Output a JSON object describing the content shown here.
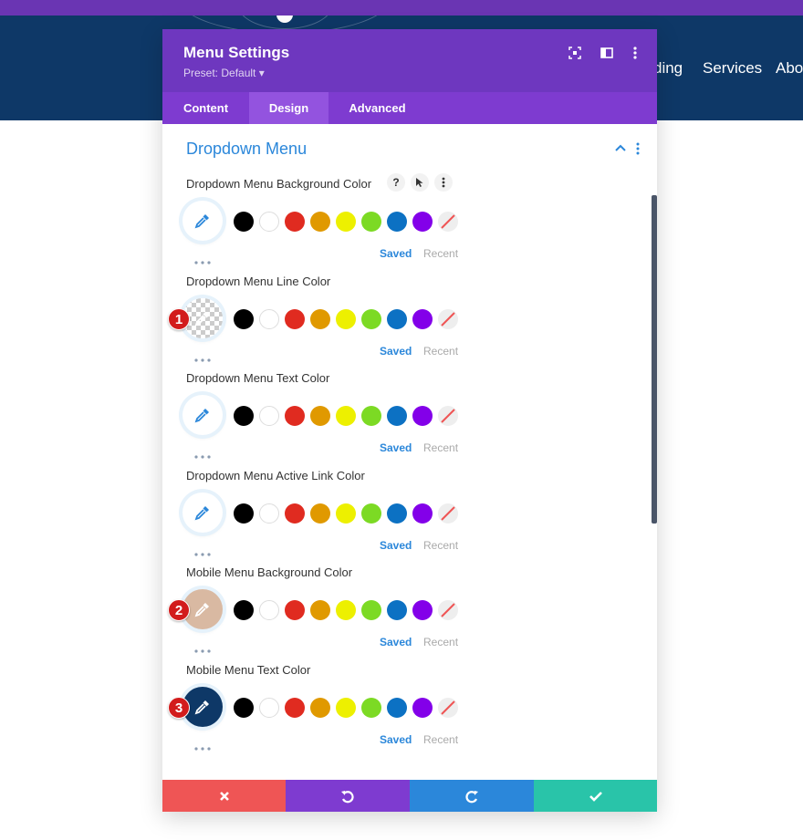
{
  "site": {
    "nav": [
      "ding",
      "Services",
      "Abo"
    ]
  },
  "modal": {
    "title": "Menu Settings",
    "preset": "Preset: Default ▾",
    "tabs": [
      "Content",
      "Design",
      "Advanced"
    ],
    "active_tab": "Design",
    "section_title": "Dropdown Menu",
    "settings": [
      {
        "label": "Dropdown Menu Background Color",
        "picker_color": "#ffffff",
        "badge": ""
      },
      {
        "label": "Dropdown Menu Line Color",
        "picker_color": "transparent",
        "badge": "1"
      },
      {
        "label": "Dropdown Menu Text Color",
        "picker_color": "#ffffff",
        "badge": ""
      },
      {
        "label": "Dropdown Menu Active Link Color",
        "picker_color": "#ffffff",
        "badge": ""
      },
      {
        "label": "Mobile Menu Background Color",
        "picker_color": "#d9b9a2",
        "badge": "2"
      },
      {
        "label": "Mobile Menu Text Color",
        "picker_color": "#0e3867",
        "badge": "3"
      }
    ],
    "saved_label": "Saved",
    "recent_label": "Recent",
    "label_tools": [
      "?",
      "pointer-icon",
      "more-icon"
    ],
    "swatches": [
      "#000000",
      "#ffffff",
      "#e02b20",
      "#e09900",
      "#edf000",
      "#7cda24",
      "#0c71c3",
      "#8300e9",
      "none"
    ],
    "footer_colors": {
      "cancel": "#ef5555",
      "undo": "#7e3bd0",
      "redo": "#2b87da",
      "save": "#29c4a9"
    }
  }
}
